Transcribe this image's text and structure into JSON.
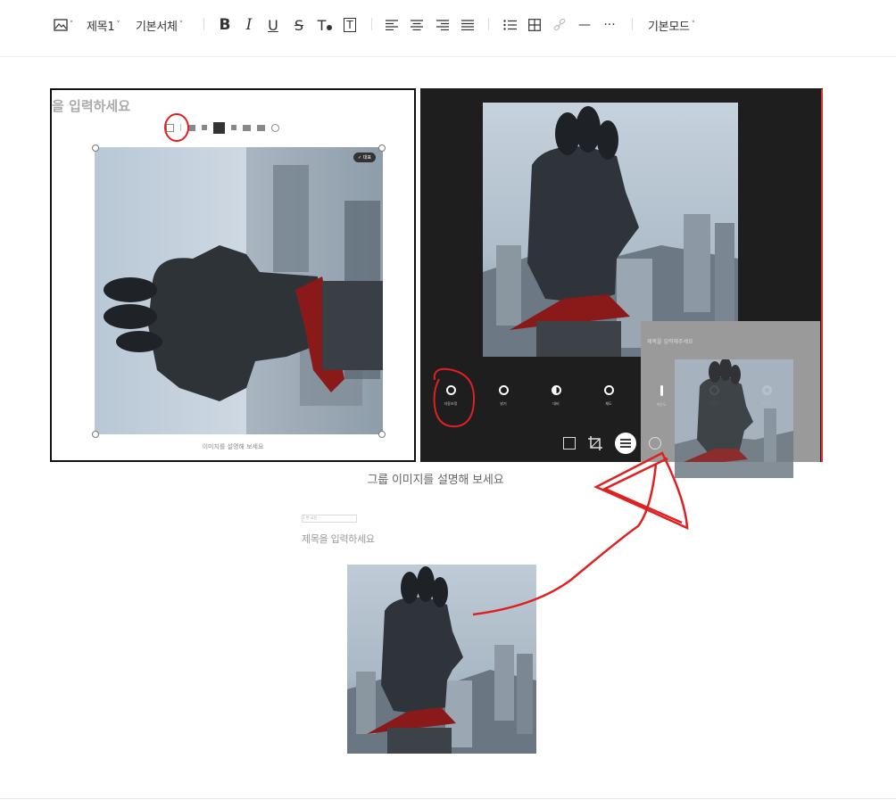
{
  "toolbar": {
    "heading_label": "제목1",
    "font_label": "기본서체",
    "mode_label": "기본모드",
    "bold": "B",
    "italic": "I",
    "underline": "U",
    "strike": "S",
    "text_color": "T",
    "text_bg": "T",
    "more": "···",
    "hr": "—"
  },
  "editor": {
    "title_placeholder": "을 입력하세요",
    "image_caption_placeholder": "이미지를 설명해 보세요",
    "group_caption_placeholder": "그룹 이미지를 설명해 보세요",
    "section_title_placeholder": "제목을 입력하세요",
    "small_input_text": "1 번 사진",
    "badge_text": "✓ 대표",
    "overlay_caption": "제목을 입력해주세요"
  },
  "photo_editor": {
    "tools": [
      {
        "label": "자동보정",
        "icon": "auto-icon"
      },
      {
        "label": "밝기",
        "icon": "brightness-icon"
      },
      {
        "label": "대비",
        "icon": "contrast-icon"
      },
      {
        "label": "채도",
        "icon": "saturation-icon"
      },
      {
        "label": "색온도",
        "icon": "temperature-icon"
      },
      {
        "label": "선명도",
        "icon": "sharpness-icon"
      },
      {
        "label": "비네팅",
        "icon": "vignette-icon"
      }
    ]
  },
  "colors": {
    "annotation_red": "#e02020",
    "dark_panel": "#1e1e1e"
  }
}
